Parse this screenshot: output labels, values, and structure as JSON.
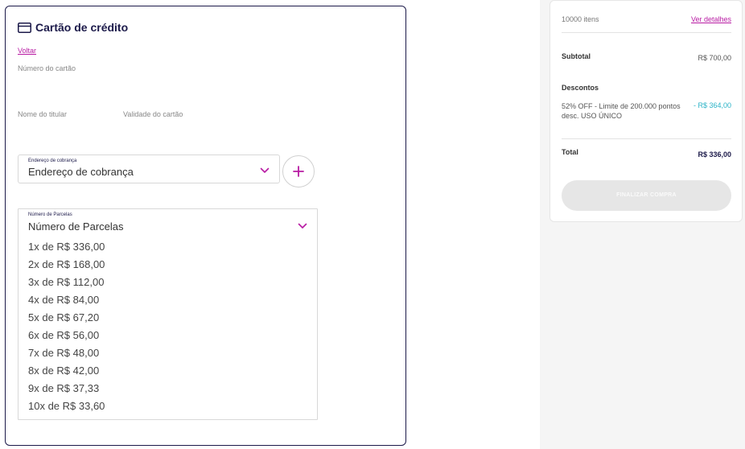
{
  "payment": {
    "title": "Cartão de crédito",
    "back_link": "Voltar",
    "card_number_label": "Número do cartão",
    "holder_label": "Nome do titular",
    "expiry_label": "Validade do cartão",
    "address": {
      "floating_label": "Endereço de cobrança",
      "value": "Endereço de cobrança"
    },
    "installments": {
      "floating_label": "Número de Parcelas",
      "value": "Número de Parcelas",
      "options": [
        "1x de R$ 336,00",
        "2x de R$ 168,00",
        "3x de R$ 112,00",
        "4x de R$ 84,00",
        "5x de R$ 67,20",
        "6x de R$ 56,00",
        "7x de R$ 48,00",
        "8x de R$ 42,00",
        "9x de R$ 37,33",
        "10x de R$ 33,60"
      ]
    }
  },
  "summary": {
    "items_count": "10000 itens",
    "details_link": "Ver detalhes",
    "subtotal_label": "Subtotal",
    "subtotal_value": "R$ 700,00",
    "discounts_label": "Descontos",
    "discount_description": "52% OFF - Limite de 200.000 pontos desc. USO ÚNICO",
    "discount_value": "- R$ 364,00",
    "total_label": "Total",
    "total_value": "R$ 336,00",
    "finalize_button": "FINALIZAR COMPRA"
  },
  "colors": {
    "navy": "#1c1a4a",
    "accent_magenta": "#b81ba3",
    "discount_teal": "#2ab3c7",
    "disabled_button": "#e6e6e6"
  },
  "icons": {
    "card": "credit-card-icon",
    "chevron": "chevron-down-icon",
    "add": "plus-icon"
  }
}
